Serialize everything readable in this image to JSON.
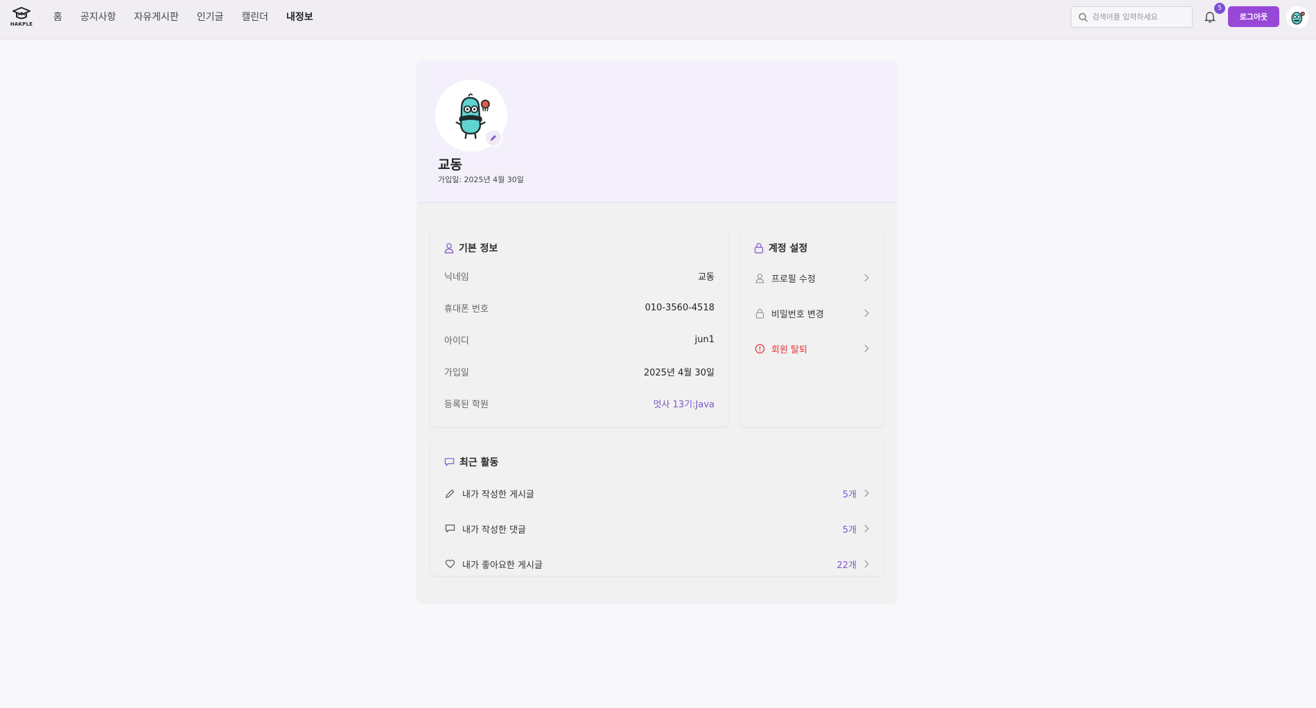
{
  "header": {
    "logo_text": "HAKPLE",
    "nav": [
      {
        "label": "홈"
      },
      {
        "label": "공지사항"
      },
      {
        "label": "자유게시판"
      },
      {
        "label": "인기글"
      },
      {
        "label": "캘린더"
      },
      {
        "label": "내정보"
      }
    ],
    "search_placeholder": "검색어를 입력하세요",
    "notification_count": "5",
    "logout_label": "로그아웃"
  },
  "profile": {
    "name": "교동",
    "joined": "가입일: 2025년 4월 30일"
  },
  "basic_info": {
    "title": "기본 정보",
    "rows": [
      {
        "label": "닉네임",
        "value": "교동"
      },
      {
        "label": "휴대폰 번호",
        "value": "010-3560-4518"
      },
      {
        "label": "아이디",
        "value": "jun1"
      },
      {
        "label": "가입일",
        "value": "2025년 4월 30일"
      },
      {
        "label": "등록된 학원",
        "value": "멋사 13기:Java"
      }
    ]
  },
  "account": {
    "title": "계정 설정",
    "items": [
      {
        "label": "프로필 수정",
        "icon": "user-icon"
      },
      {
        "label": "비밀번호 변경",
        "icon": "lock-icon"
      },
      {
        "label": "회원 탈퇴",
        "icon": "alert-icon"
      }
    ]
  },
  "activity": {
    "title": "최근 활동",
    "items": [
      {
        "label": "내가 작성한 게시글",
        "count": "5개",
        "icon": "pencil-icon"
      },
      {
        "label": "내가 작성한 댓글",
        "count": "5개",
        "icon": "comment-icon"
      },
      {
        "label": "내가 좋아요한 게시글",
        "count": "22개",
        "icon": "heart-icon"
      }
    ]
  },
  "colors": {
    "accent": "#9748d6",
    "link": "#7c56c8",
    "danger": "#e0393e",
    "mascot": "#5fd3cf"
  }
}
